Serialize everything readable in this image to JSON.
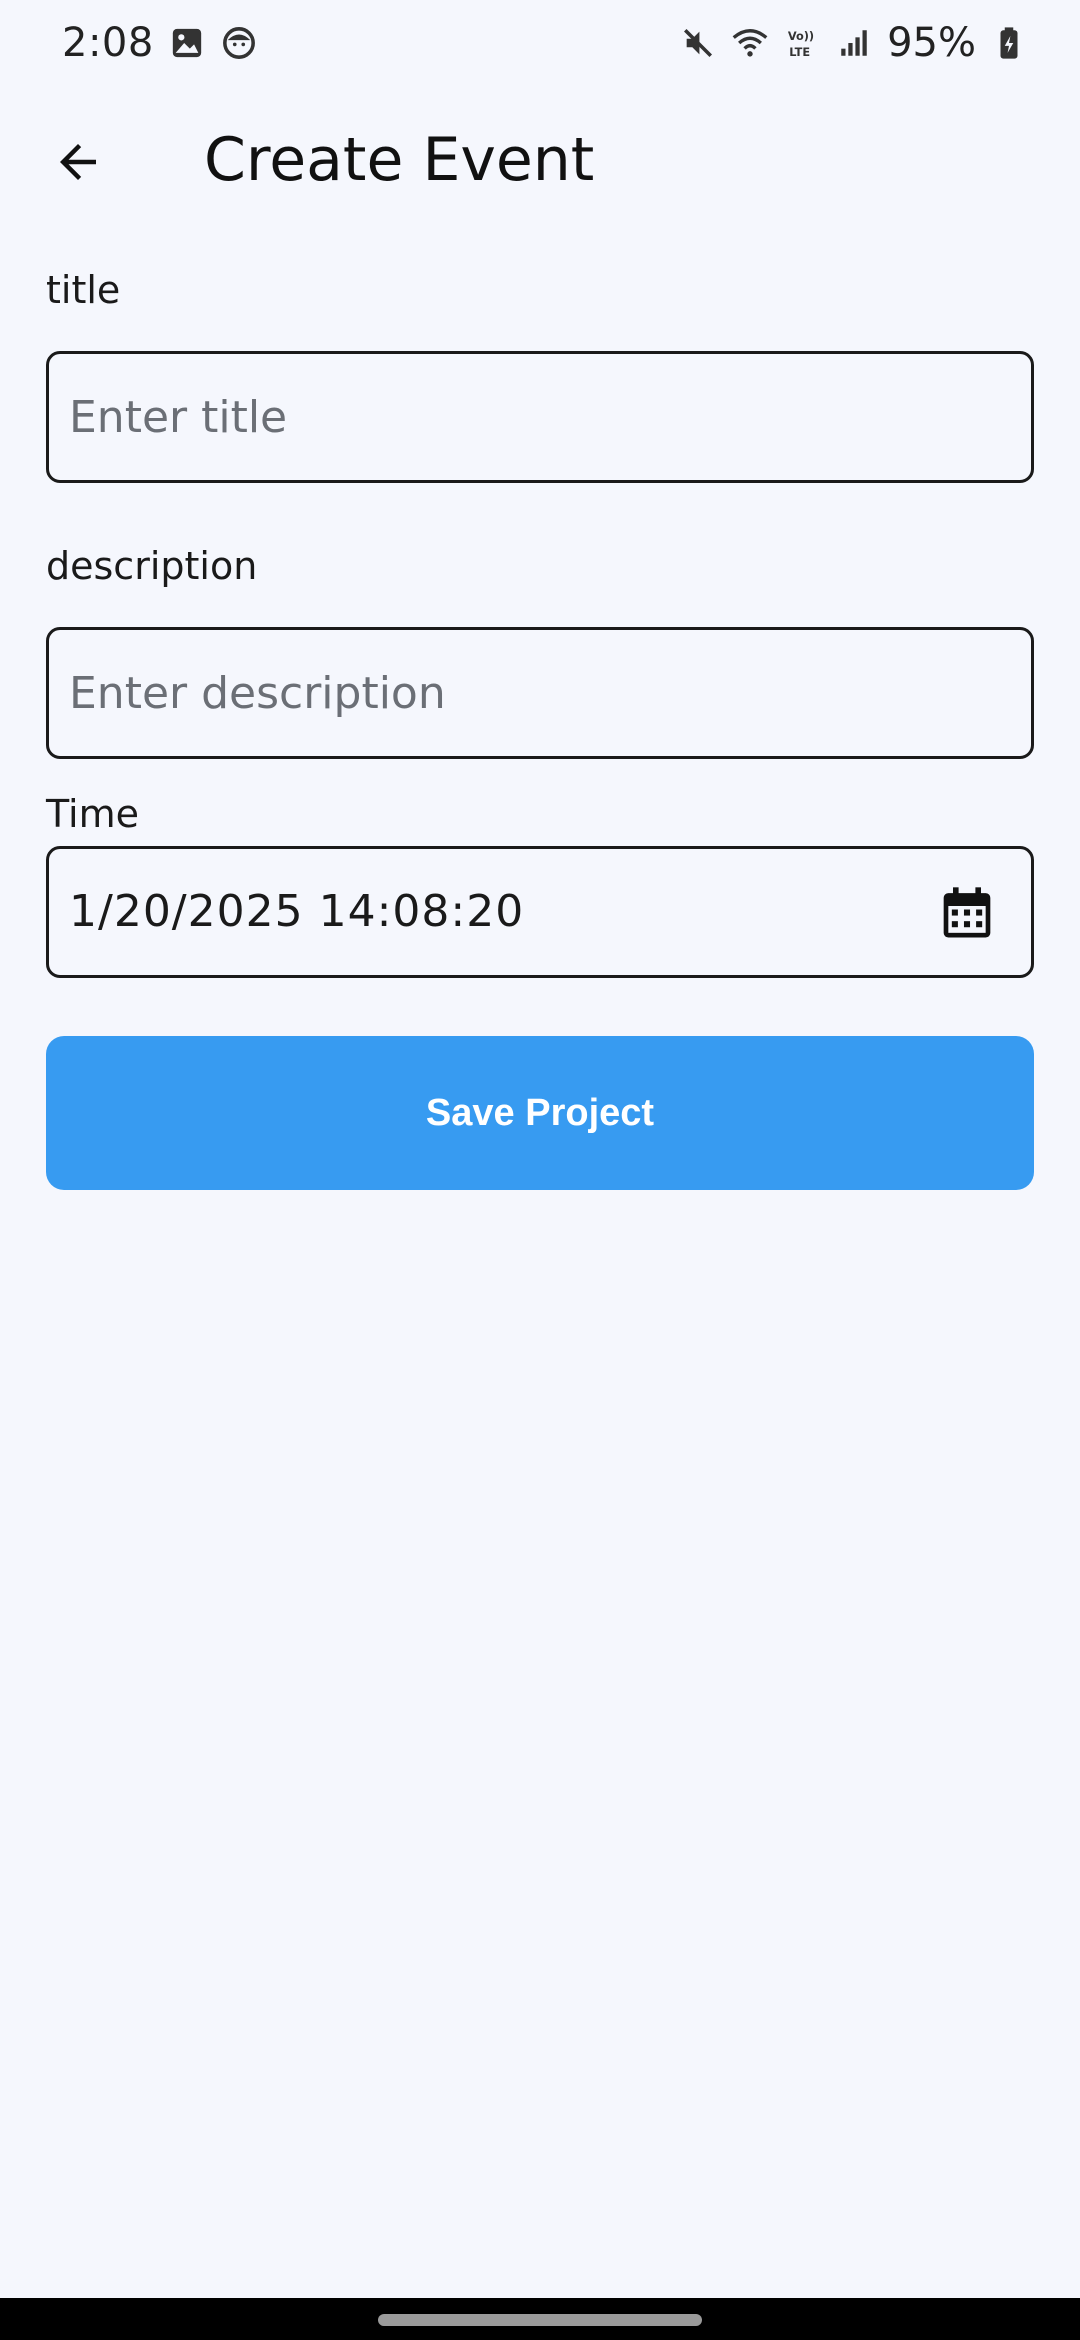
{
  "status_bar": {
    "time": "2:08",
    "battery": "95%",
    "left_icons": [
      "image-icon",
      "face-icon"
    ],
    "right_icons": [
      "mute-icon",
      "wifi-icon",
      "volte-icon",
      "signal-icon",
      "battery-icon"
    ]
  },
  "app_bar": {
    "title": "Create Event",
    "back_icon": "arrow-back-icon"
  },
  "form": {
    "title_label": "title",
    "title_placeholder": "Enter title",
    "title_value": "",
    "description_label": "description",
    "description_placeholder": "Enter description",
    "description_value": "",
    "time_label": "Time",
    "time_value": "1/20/2025 14:08:20",
    "calendar_icon": "calendar-icon",
    "save_label": "Save Project"
  },
  "colors": {
    "background": "#f5f7fd",
    "accent": "#379bf1",
    "border": "#1a1a1a"
  }
}
